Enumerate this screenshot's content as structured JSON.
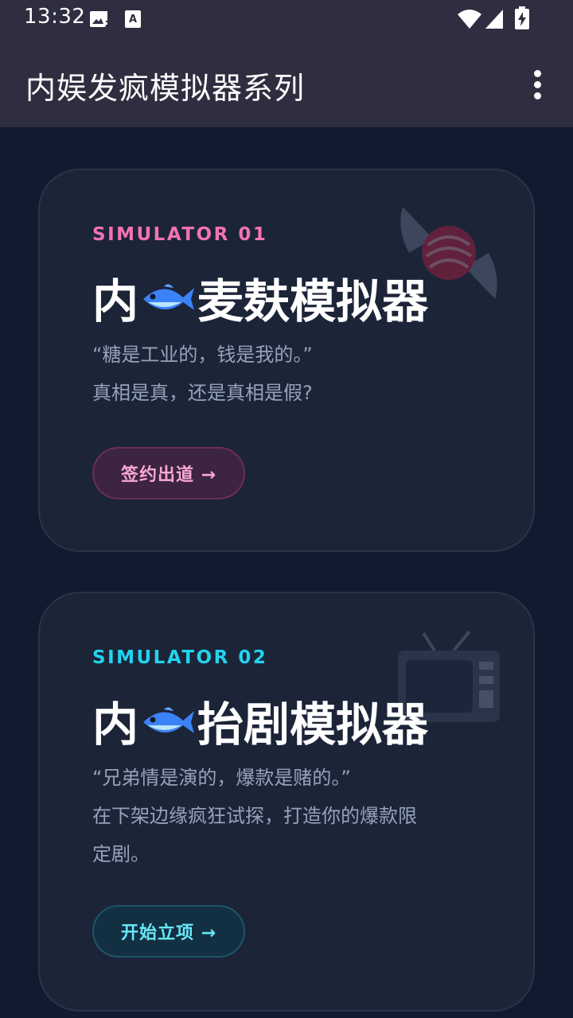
{
  "status_bar": {
    "time": "13:32",
    "icons": [
      "gallery-notification-icon",
      "keyboard-a-icon",
      "wifi-icon",
      "signal-icon",
      "battery-charging-icon"
    ]
  },
  "app_bar": {
    "title": "内娱发疯模拟器系列",
    "menu_icon": "overflow-menu-icon"
  },
  "cards": [
    {
      "tag": "SIMULATOR 01",
      "title_prefix": "内",
      "title_suffix": "麦麸模拟器",
      "title_icon": "fish-icon",
      "desc_lines": [
        "“糖是工业的，钱是我的。”",
        "真相是真，还是真相是假?"
      ],
      "button_label": "签约出道 →",
      "decoration_icon": "candy-icon",
      "accent_color": "#f472b6"
    },
    {
      "tag": "SIMULATOR 02",
      "title_prefix": "内",
      "title_suffix": "抬剧模拟器",
      "title_icon": "fish-icon",
      "desc_lines": [
        "“兄弟情是演的，爆款是赌的。”",
        "在下架边缘疯狂试探，打造你的爆款限",
        "定剧。"
      ],
      "button_label": "开始立项 →",
      "decoration_icon": "tv-icon",
      "accent_color": "#22d3ee"
    }
  ]
}
